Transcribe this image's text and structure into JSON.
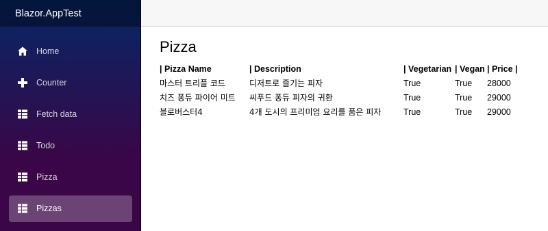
{
  "app": {
    "brand": "Blazor.AppTest"
  },
  "sidebar": {
    "items": [
      {
        "label": "Home",
        "icon": "home-icon",
        "active": false
      },
      {
        "label": "Counter",
        "icon": "plus-icon",
        "active": false
      },
      {
        "label": "Fetch data",
        "icon": "list-icon",
        "active": false
      },
      {
        "label": "Todo",
        "icon": "list-icon",
        "active": false
      },
      {
        "label": "Pizza",
        "icon": "list-icon",
        "active": false
      },
      {
        "label": "Pizzas",
        "icon": "list-icon",
        "active": true
      }
    ]
  },
  "main": {
    "title": "Pizza",
    "table": {
      "headers": [
        "| Pizza Name",
        "| Description",
        "| Vegetarian",
        "| Vegan",
        "| Price |"
      ],
      "rows": [
        [
          "마스터 트리플 코드",
          "디저트로 즐기는 피자",
          "True",
          "True",
          "28000"
        ],
        [
          "치즈 퐁듀 파이어 미트",
          "씨푸드 퐁듀 피자의 귀환",
          "True",
          "True",
          "29000"
        ],
        [
          "블로버스터4",
          "4개 도시의 프리미엄 요리를 품은 피자",
          "True",
          "True",
          "29000"
        ]
      ]
    }
  },
  "colors": {
    "sidebar_top": "#052767",
    "sidebar_bottom": "#3a0647",
    "topbar": "#f7f7f7",
    "active_item_bg": "rgba(255,255,255,0.25)"
  }
}
